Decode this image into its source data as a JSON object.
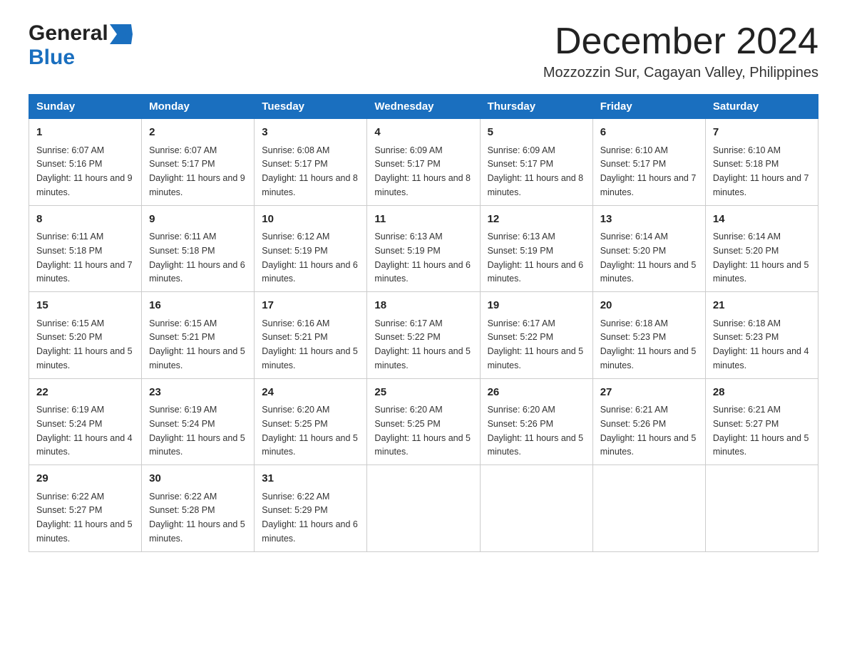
{
  "logo": {
    "general": "General",
    "blue": "Blue",
    "arrow": "▶"
  },
  "header": {
    "title": "December 2024",
    "subtitle": "Mozzozzin Sur, Cagayan Valley, Philippines"
  },
  "weekdays": [
    "Sunday",
    "Monday",
    "Tuesday",
    "Wednesday",
    "Thursday",
    "Friday",
    "Saturday"
  ],
  "weeks": [
    [
      {
        "day": "1",
        "sunrise": "Sunrise: 6:07 AM",
        "sunset": "Sunset: 5:16 PM",
        "daylight": "Daylight: 11 hours and 9 minutes."
      },
      {
        "day": "2",
        "sunrise": "Sunrise: 6:07 AM",
        "sunset": "Sunset: 5:17 PM",
        "daylight": "Daylight: 11 hours and 9 minutes."
      },
      {
        "day": "3",
        "sunrise": "Sunrise: 6:08 AM",
        "sunset": "Sunset: 5:17 PM",
        "daylight": "Daylight: 11 hours and 8 minutes."
      },
      {
        "day": "4",
        "sunrise": "Sunrise: 6:09 AM",
        "sunset": "Sunset: 5:17 PM",
        "daylight": "Daylight: 11 hours and 8 minutes."
      },
      {
        "day": "5",
        "sunrise": "Sunrise: 6:09 AM",
        "sunset": "Sunset: 5:17 PM",
        "daylight": "Daylight: 11 hours and 8 minutes."
      },
      {
        "day": "6",
        "sunrise": "Sunrise: 6:10 AM",
        "sunset": "Sunset: 5:17 PM",
        "daylight": "Daylight: 11 hours and 7 minutes."
      },
      {
        "day": "7",
        "sunrise": "Sunrise: 6:10 AM",
        "sunset": "Sunset: 5:18 PM",
        "daylight": "Daylight: 11 hours and 7 minutes."
      }
    ],
    [
      {
        "day": "8",
        "sunrise": "Sunrise: 6:11 AM",
        "sunset": "Sunset: 5:18 PM",
        "daylight": "Daylight: 11 hours and 7 minutes."
      },
      {
        "day": "9",
        "sunrise": "Sunrise: 6:11 AM",
        "sunset": "Sunset: 5:18 PM",
        "daylight": "Daylight: 11 hours and 6 minutes."
      },
      {
        "day": "10",
        "sunrise": "Sunrise: 6:12 AM",
        "sunset": "Sunset: 5:19 PM",
        "daylight": "Daylight: 11 hours and 6 minutes."
      },
      {
        "day": "11",
        "sunrise": "Sunrise: 6:13 AM",
        "sunset": "Sunset: 5:19 PM",
        "daylight": "Daylight: 11 hours and 6 minutes."
      },
      {
        "day": "12",
        "sunrise": "Sunrise: 6:13 AM",
        "sunset": "Sunset: 5:19 PM",
        "daylight": "Daylight: 11 hours and 6 minutes."
      },
      {
        "day": "13",
        "sunrise": "Sunrise: 6:14 AM",
        "sunset": "Sunset: 5:20 PM",
        "daylight": "Daylight: 11 hours and 5 minutes."
      },
      {
        "day": "14",
        "sunrise": "Sunrise: 6:14 AM",
        "sunset": "Sunset: 5:20 PM",
        "daylight": "Daylight: 11 hours and 5 minutes."
      }
    ],
    [
      {
        "day": "15",
        "sunrise": "Sunrise: 6:15 AM",
        "sunset": "Sunset: 5:20 PM",
        "daylight": "Daylight: 11 hours and 5 minutes."
      },
      {
        "day": "16",
        "sunrise": "Sunrise: 6:15 AM",
        "sunset": "Sunset: 5:21 PM",
        "daylight": "Daylight: 11 hours and 5 minutes."
      },
      {
        "day": "17",
        "sunrise": "Sunrise: 6:16 AM",
        "sunset": "Sunset: 5:21 PM",
        "daylight": "Daylight: 11 hours and 5 minutes."
      },
      {
        "day": "18",
        "sunrise": "Sunrise: 6:17 AM",
        "sunset": "Sunset: 5:22 PM",
        "daylight": "Daylight: 11 hours and 5 minutes."
      },
      {
        "day": "19",
        "sunrise": "Sunrise: 6:17 AM",
        "sunset": "Sunset: 5:22 PM",
        "daylight": "Daylight: 11 hours and 5 minutes."
      },
      {
        "day": "20",
        "sunrise": "Sunrise: 6:18 AM",
        "sunset": "Sunset: 5:23 PM",
        "daylight": "Daylight: 11 hours and 5 minutes."
      },
      {
        "day": "21",
        "sunrise": "Sunrise: 6:18 AM",
        "sunset": "Sunset: 5:23 PM",
        "daylight": "Daylight: 11 hours and 4 minutes."
      }
    ],
    [
      {
        "day": "22",
        "sunrise": "Sunrise: 6:19 AM",
        "sunset": "Sunset: 5:24 PM",
        "daylight": "Daylight: 11 hours and 4 minutes."
      },
      {
        "day": "23",
        "sunrise": "Sunrise: 6:19 AM",
        "sunset": "Sunset: 5:24 PM",
        "daylight": "Daylight: 11 hours and 5 minutes."
      },
      {
        "day": "24",
        "sunrise": "Sunrise: 6:20 AM",
        "sunset": "Sunset: 5:25 PM",
        "daylight": "Daylight: 11 hours and 5 minutes."
      },
      {
        "day": "25",
        "sunrise": "Sunrise: 6:20 AM",
        "sunset": "Sunset: 5:25 PM",
        "daylight": "Daylight: 11 hours and 5 minutes."
      },
      {
        "day": "26",
        "sunrise": "Sunrise: 6:20 AM",
        "sunset": "Sunset: 5:26 PM",
        "daylight": "Daylight: 11 hours and 5 minutes."
      },
      {
        "day": "27",
        "sunrise": "Sunrise: 6:21 AM",
        "sunset": "Sunset: 5:26 PM",
        "daylight": "Daylight: 11 hours and 5 minutes."
      },
      {
        "day": "28",
        "sunrise": "Sunrise: 6:21 AM",
        "sunset": "Sunset: 5:27 PM",
        "daylight": "Daylight: 11 hours and 5 minutes."
      }
    ],
    [
      {
        "day": "29",
        "sunrise": "Sunrise: 6:22 AM",
        "sunset": "Sunset: 5:27 PM",
        "daylight": "Daylight: 11 hours and 5 minutes."
      },
      {
        "day": "30",
        "sunrise": "Sunrise: 6:22 AM",
        "sunset": "Sunset: 5:28 PM",
        "daylight": "Daylight: 11 hours and 5 minutes."
      },
      {
        "day": "31",
        "sunrise": "Sunrise: 6:22 AM",
        "sunset": "Sunset: 5:29 PM",
        "daylight": "Daylight: 11 hours and 6 minutes."
      },
      null,
      null,
      null,
      null
    ]
  ]
}
